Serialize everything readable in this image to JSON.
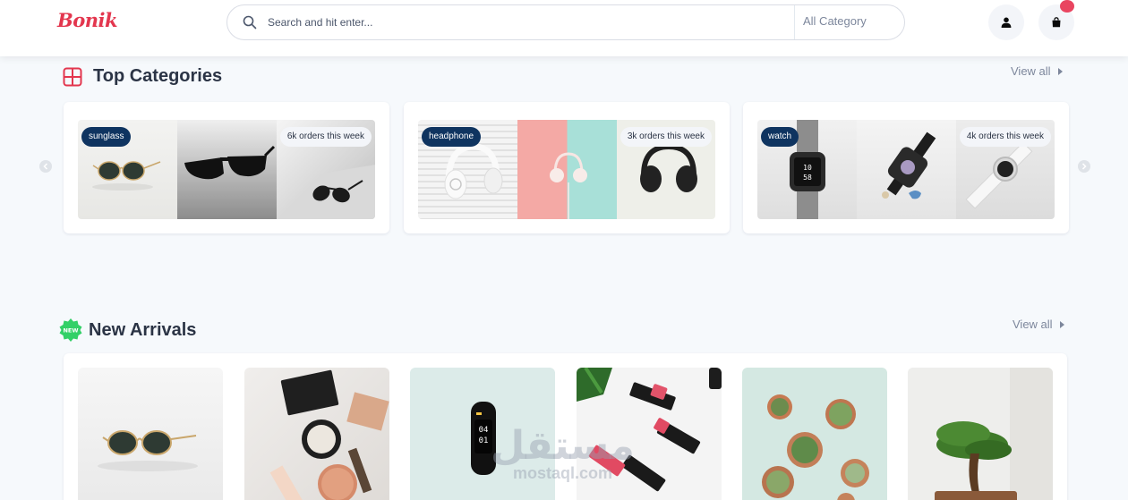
{
  "brand": {
    "logo_text": "Bonik",
    "accent_color": "#e3364e"
  },
  "search": {
    "placeholder": "Search and hit enter...",
    "category_label": "All Category"
  },
  "header_icons": [
    "search-icon",
    "user-icon",
    "shopping-bag-icon"
  ],
  "top_categories": {
    "title": "Top Categories",
    "view_all": "View all",
    "items": [
      {
        "tag": "sunglass",
        "orders": "6k orders this week"
      },
      {
        "tag": "headphone",
        "orders": "3k orders this week"
      },
      {
        "tag": "watch",
        "orders": "4k orders this week"
      }
    ]
  },
  "new_arrivals": {
    "title": "New Arrivals",
    "badge": "NEW",
    "view_all": "View all",
    "items": [
      "sunglasses",
      "makeup",
      "fitness-band",
      "lipstick",
      "succulents",
      "bonsai"
    ]
  },
  "watermark": {
    "arabic": "مستقل",
    "latin": "mostaql.com"
  }
}
